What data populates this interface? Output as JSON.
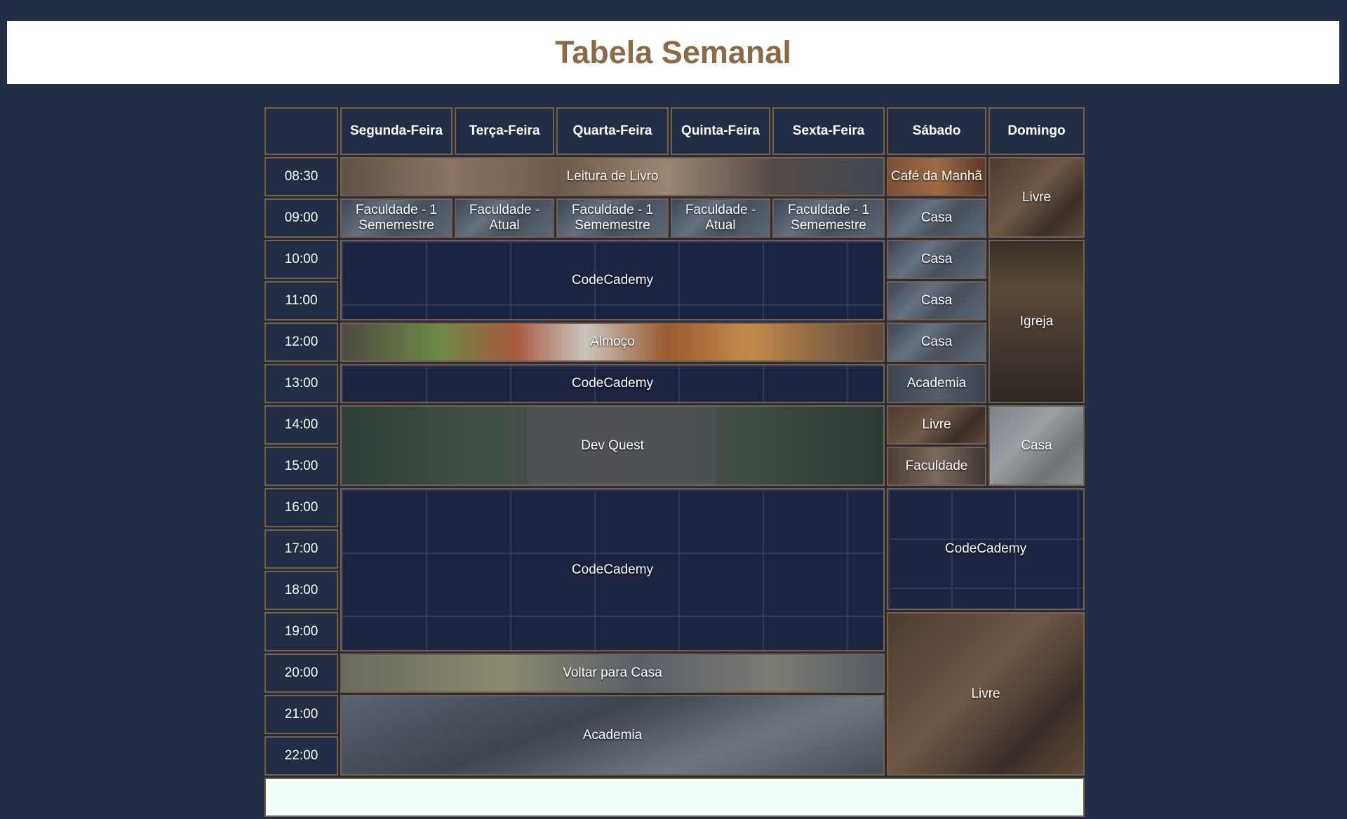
{
  "page": {
    "title": "Tabela Semanal"
  },
  "days": [
    "Segunda-Feira",
    "Terça-Feira",
    "Quarta-Feira",
    "Quinta-Feira",
    "Sexta-Feira",
    "Sábado",
    "Domingo"
  ],
  "times": [
    "08:30",
    "09:00",
    "10:00",
    "11:00",
    "12:00",
    "13:00",
    "14:00",
    "15:00",
    "16:00",
    "17:00",
    "18:00",
    "19:00",
    "20:00",
    "21:00",
    "22:00"
  ],
  "weekday": {
    "reading": "Leitura de Livro",
    "fac_mon": "Faculdade - 1 Sememestre",
    "fac_tue": "Faculdade - Atual",
    "fac_wed": "Faculdade - 1 Sememestre",
    "fac_thu": "Faculdade - Atual",
    "fac_fri": "Faculdade - 1 Sememestre",
    "codecademy_morning": "CodeCademy",
    "lunch": "Almoço",
    "codecademy_afternoon": "CodeCademy",
    "dev_quest": "Dev Quest",
    "codecademy_evening": "CodeCademy",
    "go_home": "Voltar para Casa",
    "gym": "Academia"
  },
  "saturday": {
    "breakfast": "Café da Manhã",
    "home_0900": "Casa",
    "home_1000": "Casa",
    "home_1100": "Casa",
    "home_1200": "Casa",
    "gym": "Academia",
    "free": "Livre",
    "college": "Faculdade"
  },
  "sunday": {
    "free_morning": "Livre",
    "church": "Igreja",
    "home": "Casa"
  },
  "weekend": {
    "codecademy": "CodeCademy",
    "free_night": "Livre"
  },
  "footer": {
    "label": "Fim"
  }
}
